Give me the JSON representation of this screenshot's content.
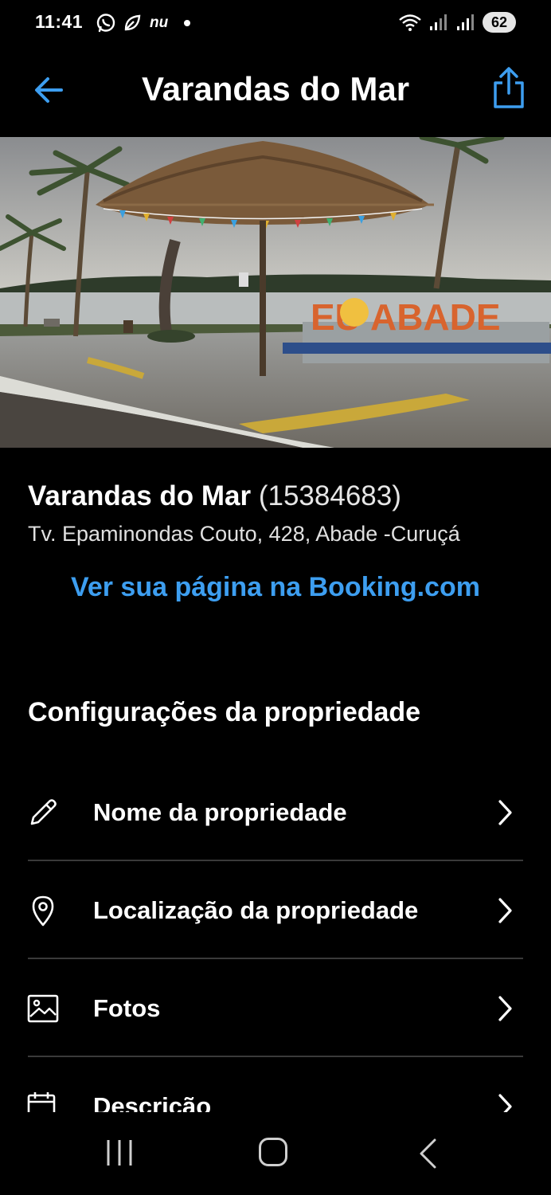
{
  "status_bar": {
    "time": "11:41",
    "left_icons": [
      "whatsapp-icon",
      "leaf-icon",
      "nu-icon"
    ],
    "nu_label": "nu",
    "right_icons": [
      "wifi-icon",
      "signal-icon",
      "signal-icon"
    ],
    "battery": "62"
  },
  "header": {
    "title": "Varandas do Mar",
    "back_icon": "back-arrow-icon",
    "share_icon": "share-icon",
    "accent_color": "#3d9ef0"
  },
  "hero": {
    "sign_text": "EU ABADE"
  },
  "property": {
    "name": "Varandas do Mar",
    "id": "(15384683)",
    "address": "Tv. Epaminondas Couto, 428, Abade -Curuçá",
    "booking_link": "Ver sua página na Booking.com"
  },
  "settings": {
    "heading": "Configurações da propriedade",
    "items": [
      {
        "label": "Nome da propriedade",
        "icon": "pencil-icon"
      },
      {
        "label": "Localização da propriedade",
        "icon": "location-pin-icon"
      },
      {
        "label": "Fotos",
        "icon": "photo-icon"
      },
      {
        "label": "Descrição",
        "icon": "calendar-edit-icon"
      }
    ]
  },
  "nav_bar": {
    "icons": [
      "recent-apps-icon",
      "home-icon",
      "back-icon"
    ]
  }
}
